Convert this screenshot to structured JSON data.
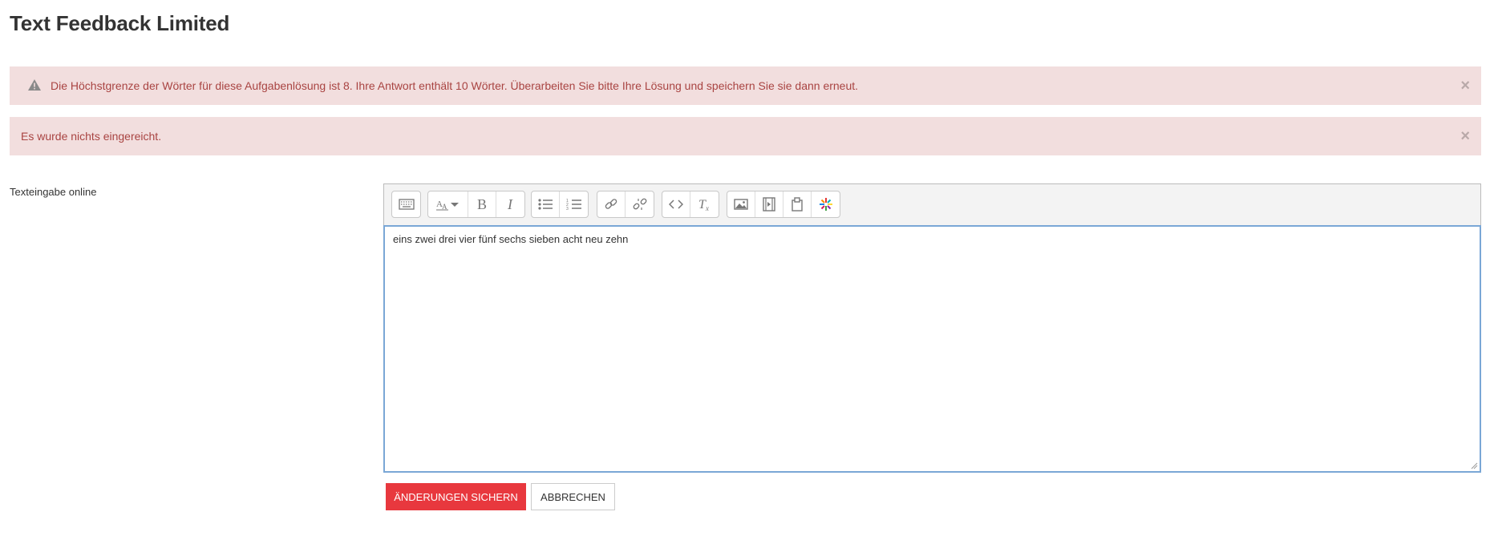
{
  "page": {
    "title": "Text Feedback Limited"
  },
  "alerts": [
    {
      "text": "Die Höchstgrenze der Wörter für diese Aufgabenlösung ist 8. Ihre Antwort enthält 10 Wörter. Überarbeiten Sie bitte Ihre Lösung und speichern Sie sie dann erneut.",
      "close": "×",
      "icon": "warning-icon"
    },
    {
      "text": "Es wurde nichts eingereicht.",
      "close": "×"
    }
  ],
  "form": {
    "label": "Texteingabe online",
    "editor": {
      "content": "eins zwei drei vier fünf sechs sieben acht neu zehn",
      "toolbar_icons": [
        [
          "toolbar-toggle-icon"
        ],
        [
          "font-size-icon",
          "bold-icon",
          "italic-icon"
        ],
        [
          "bullet-list-icon",
          "numbered-list-icon"
        ],
        [
          "link-icon",
          "unlink-icon"
        ],
        [
          "html-source-icon",
          "clear-formatting-icon"
        ],
        [
          "image-icon",
          "media-icon",
          "manage-files-icon",
          "accessibility-icon"
        ]
      ]
    },
    "save_label": "ÄNDERUNGEN SICHERN",
    "cancel_label": "ABBRECHEN"
  },
  "colors": {
    "alert_bg": "#f2dede",
    "alert_text": "#a94442",
    "primary_button": "#e8383e",
    "editor_focus_border": "#7aa7d6"
  }
}
